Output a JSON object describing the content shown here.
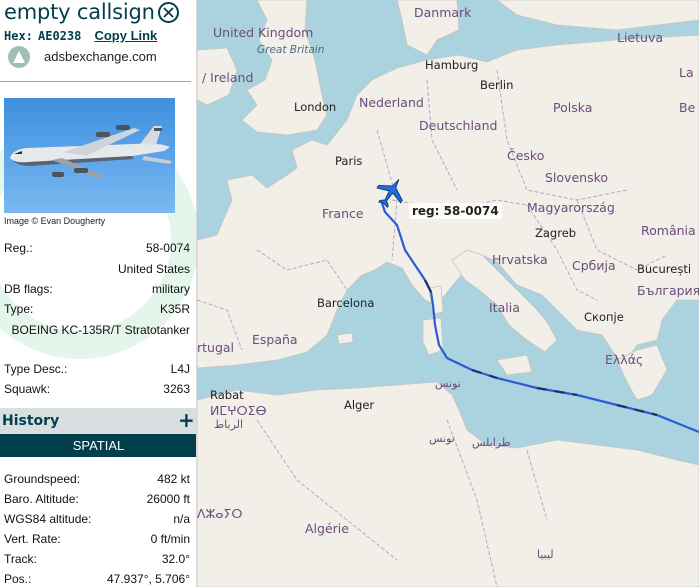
{
  "header": {
    "callsign": "empty callsign",
    "hex_label": "Hex:",
    "hex_value": "AE0238",
    "copy_link": "Copy Link",
    "site": "adsbexchange.com"
  },
  "photo": {
    "credit": "Image © Evan Dougherty"
  },
  "details": {
    "reg_label": "Reg.:",
    "reg_value": "58-0074",
    "country": "United States",
    "dbflags_label": "DB flags:",
    "dbflags_value": "military",
    "type_label": "Type:",
    "type_value": "K35R",
    "type_long": "BOEING KC-135R/T Stratotanker",
    "typedesc_label": "Type Desc.:",
    "typedesc_value": "L4J",
    "squawk_label": "Squawk:",
    "squawk_value": "3263"
  },
  "history": {
    "title": "History",
    "plus": "+",
    "spatial": "SPATIAL"
  },
  "spatial": {
    "groundspeed_label": "Groundspeed:",
    "groundspeed_value": "482 kt",
    "baro_label": "Baro. Altitude:",
    "baro_value": "26000 ft",
    "wgs_label": "WGS84 altitude:",
    "wgs_value": "n/a",
    "vert_label": "Vert. Rate:",
    "vert_value": "0 ft/min",
    "track_label": "Track:",
    "track_value": "32.0°",
    "pos_label": "Pos.:",
    "pos_value": "47.937°, 5.706°"
  },
  "map": {
    "aircraft_label": "reg: 58-0074",
    "labels": {
      "danmark": "Danmark",
      "united_kingdom": "United Kingdom",
      "great_britain": "Great Britain",
      "ireland": "/ Ireland",
      "hamburg": "Hamburg",
      "berlin": "Berlin",
      "london": "London",
      "nederland": "Nederland",
      "polska": "Polska",
      "lietuva": "Lietuva",
      "la_edge": "La",
      "be_edge": "Be",
      "deutschland": "Deutschland",
      "cesko": "Česko",
      "paris": "Paris",
      "france": "France",
      "slovensko": "Slovensko",
      "magyarorszag": "Magyarország",
      "zagreb": "Zagreb",
      "romania": "România",
      "hrvatska": "Hrvatska",
      "srbija": "Србија",
      "bucuresti": "București",
      "balgariya": "България",
      "skopje": "Скопје",
      "barcelona": "Barcelona",
      "espana": "España",
      "italia": "Italia",
      "portugal": "rtugal",
      "ellas": "Ελλάς",
      "rabat": "Rabat",
      "tifinagh": "ⵍⵎⵖⵔⵉⴱ",
      "arabic_ribat": "الرباط",
      "alger": "Alger",
      "tunis": "تونس",
      "tunis2": "تونس",
      "tripoli": "طرابلس",
      "algerie": "Algérie",
      "libya": "ليبيا",
      "tifinagh2": "ⴷⵣⴰⵢⵔ"
    }
  },
  "colors": {
    "primary": "#003f4b",
    "water": "#aad3df",
    "land": "#f2efe9",
    "track_blue": "#2b5bd7",
    "aircraft_blue": "#1e6fd9"
  }
}
